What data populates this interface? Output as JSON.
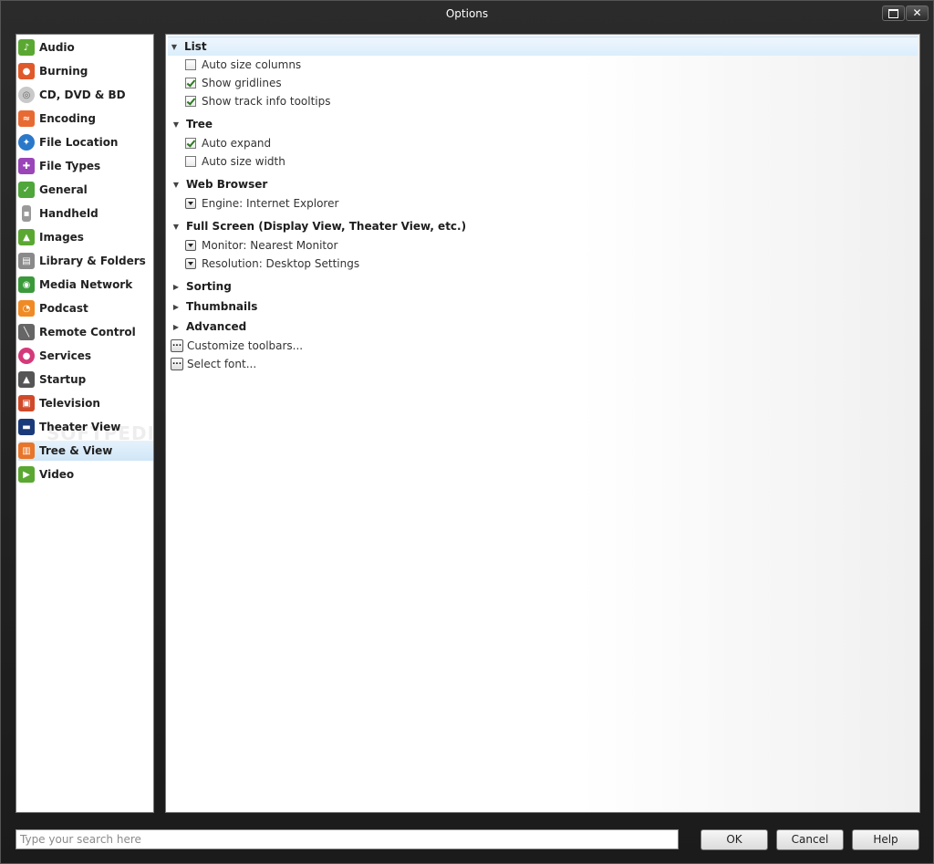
{
  "window": {
    "title": "Options"
  },
  "sidebar": {
    "items": [
      {
        "label": "Audio",
        "icon": "audio-icon",
        "color": "#5aa832"
      },
      {
        "label": "Burning",
        "icon": "burning-icon",
        "color": "#e0592a"
      },
      {
        "label": "CD, DVD & BD",
        "icon": "disc-icon",
        "color": "#c9c9c9"
      },
      {
        "label": "Encoding",
        "icon": "encoding-icon",
        "color": "#e86a33"
      },
      {
        "label": "File Location",
        "icon": "globe-icon",
        "color": "#2a78c9"
      },
      {
        "label": "File Types",
        "icon": "puzzle-icon",
        "color": "#9a45b8"
      },
      {
        "label": "General",
        "icon": "general-icon",
        "color": "#4fa63a"
      },
      {
        "label": "Handheld",
        "icon": "handheld-icon",
        "color": "#9a9a9a"
      },
      {
        "label": "Images",
        "icon": "images-icon",
        "color": "#5aa832"
      },
      {
        "label": "Library & Folders",
        "icon": "library-icon",
        "color": "#8a8a8a"
      },
      {
        "label": "Media Network",
        "icon": "network-icon",
        "color": "#3a9a3a"
      },
      {
        "label": "Podcast",
        "icon": "podcast-icon",
        "color": "#f08a24"
      },
      {
        "label": "Remote Control",
        "icon": "remote-icon",
        "color": "#666666"
      },
      {
        "label": "Services",
        "icon": "services-icon",
        "color": "#d43a7a"
      },
      {
        "label": "Startup",
        "icon": "startup-icon",
        "color": "#555555"
      },
      {
        "label": "Television",
        "icon": "television-icon",
        "color": "#d04a2a"
      },
      {
        "label": "Theater View",
        "icon": "theater-icon",
        "color": "#1a3a7a"
      },
      {
        "label": "Tree & View",
        "icon": "tree-view-icon",
        "color": "#e8752a"
      },
      {
        "label": "Video",
        "icon": "video-icon",
        "color": "#5aa832"
      }
    ],
    "selected": "Tree & View",
    "watermark": "SOFTPEDIA"
  },
  "content": {
    "list_header": "List",
    "list_auto_size": "Auto size columns",
    "list_gridlines": "Show gridlines",
    "list_tooltips": "Show track info tooltips",
    "tree_header": "Tree",
    "tree_auto_expand": "Auto expand",
    "tree_auto_width": "Auto size width",
    "web_header": "Web Browser",
    "web_engine": "Engine: Internet Explorer",
    "full_header": "Full Screen (Display View, Theater View, etc.)",
    "full_monitor": "Monitor: Nearest Monitor",
    "full_resolution": "Resolution: Desktop Settings",
    "sorting_header": "Sorting",
    "thumbnails_header": "Thumbnails",
    "advanced_header": "Advanced",
    "customize_toolbars": "Customize toolbars...",
    "select_font": "Select font...",
    "ellipsis": "..."
  },
  "footer": {
    "search_placeholder": "Type your search here",
    "ok": "OK",
    "cancel": "Cancel",
    "help": "Help"
  }
}
